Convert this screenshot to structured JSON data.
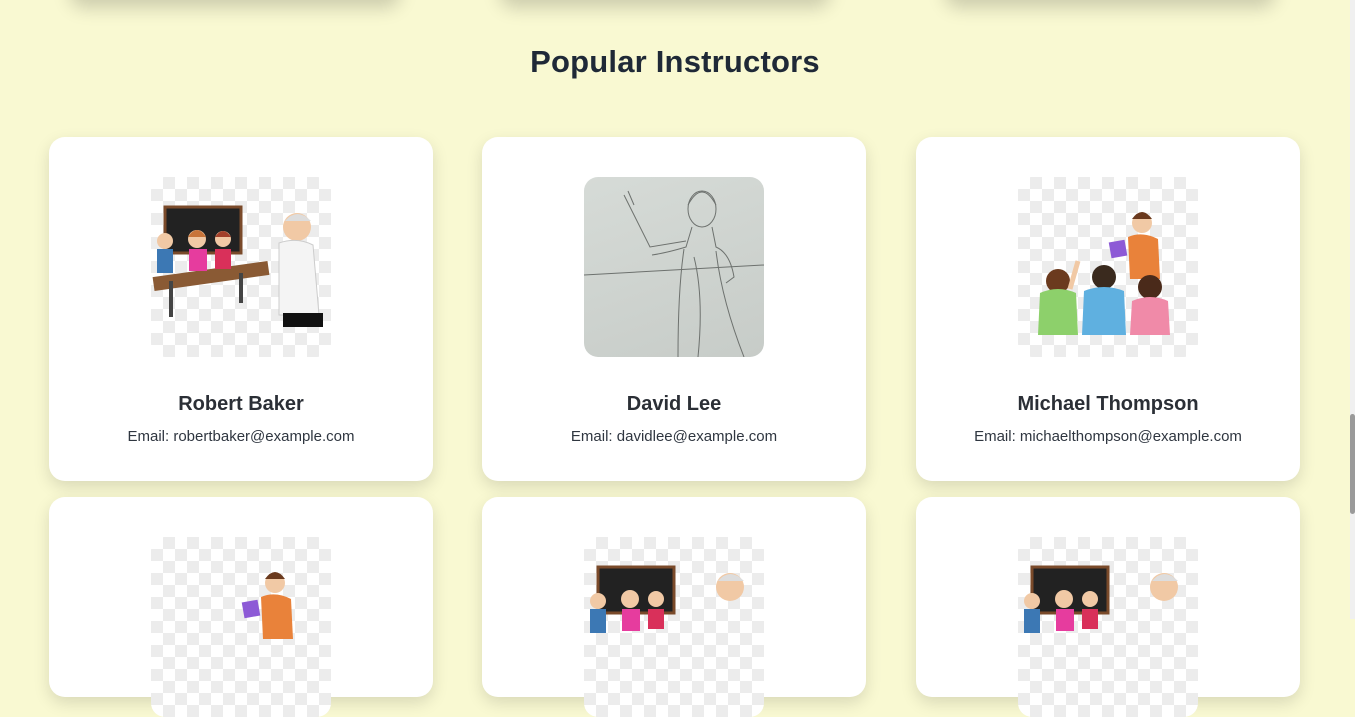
{
  "section": {
    "title": "Popular Instructors"
  },
  "instructors": [
    {
      "name": "Robert Baker",
      "email": "Email: robertbaker@example.com",
      "image": "classroom-teacher"
    },
    {
      "name": "David Lee",
      "email": "Email: davidlee@example.com",
      "image": "sketch-teacher"
    },
    {
      "name": "Michael Thompson",
      "email": "Email: michaelthompson@example.com",
      "image": "teacher-with-kids"
    }
  ],
  "colors": {
    "background": "#f9f9d2",
    "card": "#ffffff",
    "text": "#1f2937"
  }
}
